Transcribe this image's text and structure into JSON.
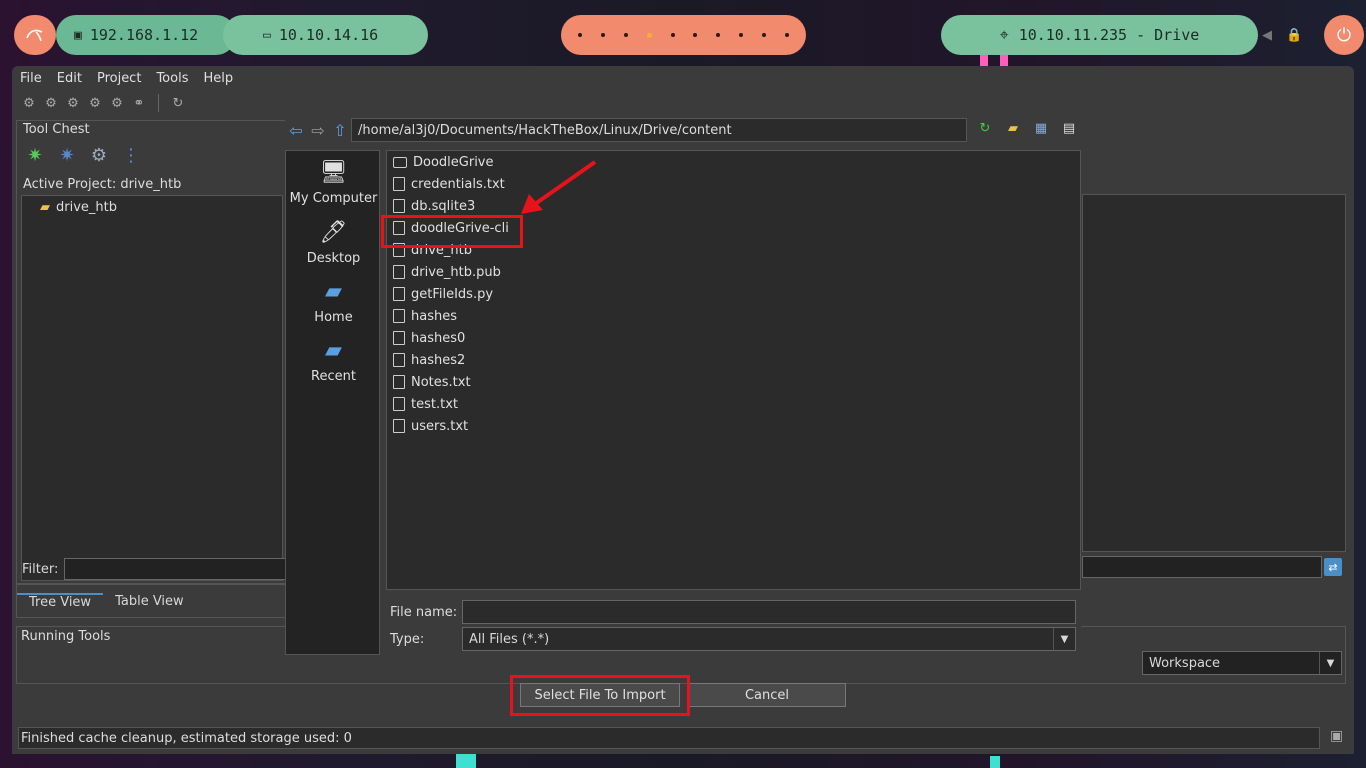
{
  "topbar": {
    "ip_local": "192.168.1.12",
    "ip_vpn": "10.10.14.16",
    "target": "10.10.11.235 - Drive",
    "workspaces": [
      "1",
      "2",
      "3",
      "4",
      "5",
      "6",
      "7",
      "8",
      "9",
      "10"
    ],
    "active_workspace": 4
  },
  "menu": [
    "File",
    "Edit",
    "Project",
    "Tools",
    "Help"
  ],
  "panels": {
    "tool_chest": "Tool Chest",
    "active_project": "Active Project: drive_htb",
    "project_root": "drive_htb",
    "filter_label": "Filter:",
    "tree_view": "Tree View",
    "table_view": "Table View",
    "running_tools": "Running Tools",
    "workspace": "Workspace"
  },
  "status": "Finished cache cleanup, estimated storage used: 0",
  "dialog": {
    "path": "/home/al3j0/Documents/HackTheBox/Linux/Drive/content",
    "places": [
      "My Computer",
      "Desktop",
      "Home",
      "Recent"
    ],
    "files": [
      {
        "name": "DoodleGrive",
        "type": "folder"
      },
      {
        "name": "credentials.txt",
        "type": "file"
      },
      {
        "name": "db.sqlite3",
        "type": "file"
      },
      {
        "name": "doodleGrive-cli",
        "type": "file"
      },
      {
        "name": "drive_htb",
        "type": "file"
      },
      {
        "name": "drive_htb.pub",
        "type": "file"
      },
      {
        "name": "getFileIds.py",
        "type": "file"
      },
      {
        "name": "hashes",
        "type": "file"
      },
      {
        "name": "hashes0",
        "type": "file"
      },
      {
        "name": "hashes2",
        "type": "file"
      },
      {
        "name": "Notes.txt",
        "type": "file"
      },
      {
        "name": "test.txt",
        "type": "file"
      },
      {
        "name": "users.txt",
        "type": "file"
      }
    ],
    "file_name_label": "File name:",
    "file_name_value": "",
    "type_label": "Type:",
    "type_value": "All Files (*.*)",
    "select_button": "Select File To Import",
    "cancel_button": "Cancel"
  },
  "colors": {
    "highlight": "#e8121b",
    "accent": "#4a90c8"
  }
}
